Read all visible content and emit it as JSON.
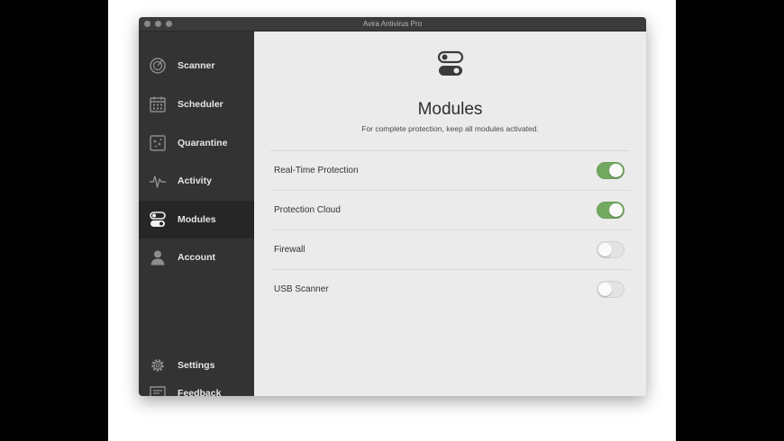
{
  "window": {
    "title": "Avira Antivirus Pro"
  },
  "sidebar": {
    "items": [
      {
        "label": "Scanner",
        "icon": "scanner-icon"
      },
      {
        "label": "Scheduler",
        "icon": "calendar-icon"
      },
      {
        "label": "Quarantine",
        "icon": "quarantine-icon"
      },
      {
        "label": "Activity",
        "icon": "activity-icon"
      },
      {
        "label": "Modules",
        "icon": "toggles-icon",
        "active": true
      },
      {
        "label": "Account",
        "icon": "user-icon"
      }
    ],
    "bottom_items": [
      {
        "label": "Settings",
        "icon": "gear-icon"
      },
      {
        "label": "Feedback",
        "icon": "feedback-icon"
      }
    ]
  },
  "main": {
    "title": "Modules",
    "subtitle": "For complete protection, keep all modules activated.",
    "modules": [
      {
        "label": "Real-Time Protection",
        "enabled": true
      },
      {
        "label": "Protection Cloud",
        "enabled": true
      },
      {
        "label": "Firewall",
        "enabled": false
      },
      {
        "label": "USB Scanner",
        "enabled": false
      }
    ]
  },
  "colors": {
    "sidebar_bg": "#333333",
    "sidebar_active_bg": "#262626",
    "toggle_on": "#72a860",
    "content_bg": "#ebebeb"
  }
}
